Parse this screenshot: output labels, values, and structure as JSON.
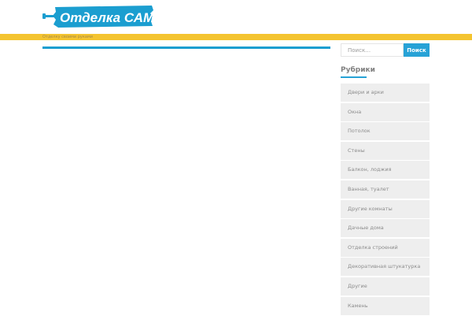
{
  "header": {
    "logo_text": "Отделка САМ.ru",
    "tagline": "Отделку своими руками"
  },
  "sidebar": {
    "search": {
      "placeholder": "Поиск…",
      "button_label": "Поиск"
    },
    "categories": {
      "title": "Рубрики",
      "items": [
        {
          "label": "Двери и арки"
        },
        {
          "label": "Окна"
        },
        {
          "label": "Потолок"
        },
        {
          "label": "Стены"
        },
        {
          "label": "Балкон, лоджия"
        },
        {
          "label": "Ванная, туалет"
        },
        {
          "label": "Другие комнаты"
        },
        {
          "label": "Дачные дома"
        },
        {
          "label": "Отделка строений"
        },
        {
          "label": "Декоративная штукатурка"
        },
        {
          "label": "Другие"
        },
        {
          "label": "Камень"
        }
      ]
    }
  },
  "colors": {
    "accent_blue": "#27a2d6",
    "header_yellow": "#f4c430",
    "item_bg": "#eeeeee"
  }
}
